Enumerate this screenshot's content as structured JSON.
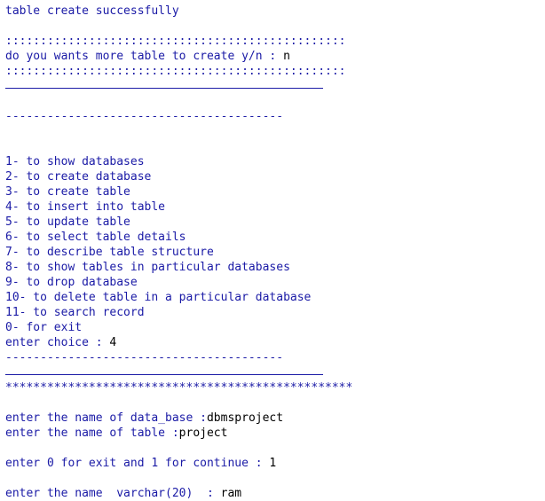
{
  "console": {
    "lines": [
      {
        "text": "table create successfully"
      },
      {
        "text": ""
      },
      {
        "text": ":::::::::::::::::::::::::::::::::::::::::::::::::"
      },
      {
        "text": "do you wants more table to create y/n : ",
        "value": "n"
      },
      {
        "text": ":::::::::::::::::::::::::::::::::::::::::::::::::"
      },
      {
        "rule": true
      },
      {
        "text": ""
      },
      {
        "text": "----------------------------------------"
      },
      {
        "text": ""
      },
      {
        "text": ""
      },
      {
        "text": "1- to show databases"
      },
      {
        "text": "2- to create database"
      },
      {
        "text": "3- to create table"
      },
      {
        "text": "4- to insert into table"
      },
      {
        "text": "5- to update table"
      },
      {
        "text": "6- to select table details"
      },
      {
        "text": "7- to describe table structure"
      },
      {
        "text": "8- to show tables in particular databases"
      },
      {
        "text": "9- to drop database"
      },
      {
        "text": "10- to delete table in a particular database"
      },
      {
        "text": "11- to search record"
      },
      {
        "text": "0- for exit"
      },
      {
        "text": "enter choice : ",
        "value": "4"
      },
      {
        "text": "----------------------------------------"
      },
      {
        "rule": true
      },
      {
        "text": "**************************************************"
      },
      {
        "text": ""
      },
      {
        "text": "enter the name of data_base :",
        "value": "dbmsproject"
      },
      {
        "text": "enter the name of table :",
        "value": "project"
      },
      {
        "text": ""
      },
      {
        "text": "enter 0 for exit and 1 for continue : ",
        "value": "1"
      },
      {
        "text": ""
      },
      {
        "text": "enter the name  varchar(20)  : ",
        "value": "ram"
      }
    ]
  }
}
